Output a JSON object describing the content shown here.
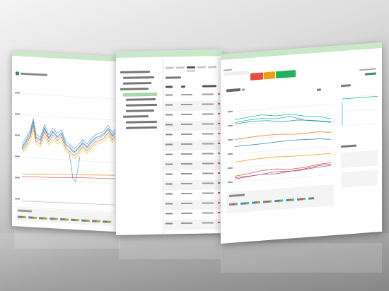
{
  "screens": {
    "left": {
      "title": ""
    },
    "middle": {
      "title": ""
    },
    "right": {
      "title": ""
    }
  },
  "colors": {
    "accent": "#3d8b5a",
    "accent_light": "#c9e7c9",
    "nav_text": "#e8a24a",
    "warn": "#e74c3c",
    "orange": "#f39c12",
    "panel": "#ffffff",
    "line_gray": "#e3e3e3"
  }
}
